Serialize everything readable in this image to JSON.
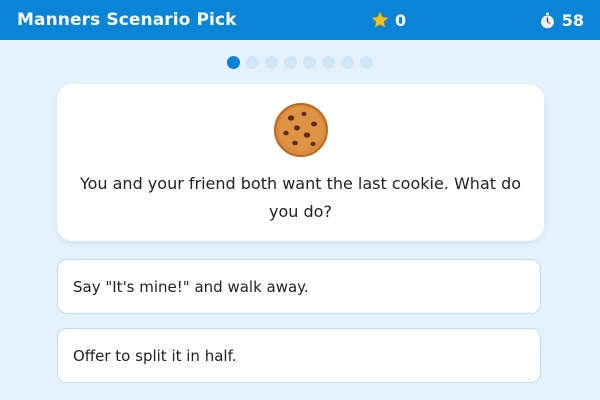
{
  "header": {
    "title": "Manners Scenario Pick",
    "score": "0",
    "timer": "58",
    "score_icon": "star-icon",
    "timer_icon": "stopwatch-icon"
  },
  "progress": {
    "total": 8,
    "current": 1
  },
  "question": {
    "icon": "cookie-icon",
    "text": "You and your friend both want the last cookie. What do you do?"
  },
  "options": [
    {
      "label": "Say \"It's mine!\" and walk away."
    },
    {
      "label": "Offer to split it in half."
    }
  ],
  "colors": {
    "header": "#0a84d6",
    "background": "#e5f2fc",
    "dot_active": "#0a84d6",
    "dot_inactive": "#cfe6f8",
    "option_border": "#bcdcf4"
  }
}
